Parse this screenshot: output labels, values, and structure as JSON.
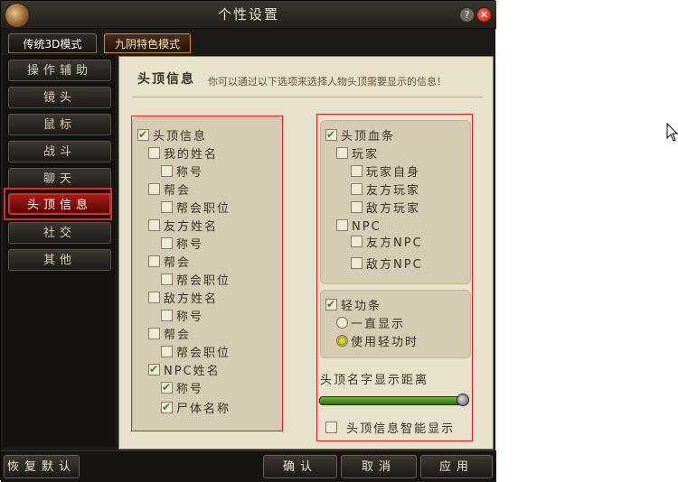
{
  "window": {
    "title": "个性设置"
  },
  "tabs": [
    {
      "label": "传统3D模式",
      "active": false
    },
    {
      "label": "九阴特色模式",
      "active": true
    }
  ],
  "sidebar": {
    "items": [
      {
        "label": "操作辅助"
      },
      {
        "label": "镜头"
      },
      {
        "label": "鼠标"
      },
      {
        "label": "战斗"
      },
      {
        "label": "聊天"
      },
      {
        "label": "头顶信息",
        "active": true
      },
      {
        "label": "社交"
      },
      {
        "label": "其他"
      }
    ]
  },
  "main": {
    "title": "头顶信息",
    "description": "你可以通过以下选项来选择人物头顶需要显示的信息！"
  },
  "left_column": {
    "items": [
      {
        "label": "头顶信息",
        "checked": true
      },
      {
        "label": "我的姓名",
        "checked": false
      },
      {
        "label": "称号",
        "checked": false
      },
      {
        "label": "帮会",
        "checked": false
      },
      {
        "label": "帮会职位",
        "checked": false
      },
      {
        "label": "友方姓名",
        "checked": false
      },
      {
        "label": "称号",
        "checked": false
      },
      {
        "label": "帮会",
        "checked": false
      },
      {
        "label": "帮会职位",
        "checked": false
      },
      {
        "label": "敌方姓名",
        "checked": false
      },
      {
        "label": "称号",
        "checked": false
      },
      {
        "label": "帮会",
        "checked": false
      },
      {
        "label": "帮会职位",
        "checked": false
      },
      {
        "label": "NPC姓名",
        "checked": true
      },
      {
        "label": "称号",
        "checked": true
      },
      {
        "label": "尸体名称",
        "checked": true
      }
    ]
  },
  "right_column": {
    "hp_items": [
      {
        "label": "头顶血条",
        "checked": true
      },
      {
        "label": "玩家",
        "checked": false
      },
      {
        "label": "玩家自身",
        "checked": false
      },
      {
        "label": "友方玩家",
        "checked": false
      },
      {
        "label": "敌方玩家",
        "checked": false
      },
      {
        "label": "NPC",
        "checked": false
      },
      {
        "label": "友方NPC",
        "checked": false
      },
      {
        "label": "敌方NPC",
        "checked": false
      }
    ],
    "qinggong": {
      "label": "轻功条",
      "checked": true,
      "options": [
        {
          "label": "一直显示",
          "selected": false
        },
        {
          "label": "使用轻功时",
          "selected": true
        }
      ]
    },
    "distance": {
      "label": "头顶名字显示距离",
      "value_fraction": 0.97
    },
    "smart_display": {
      "label": "头顶信息智能显示",
      "checked": false
    }
  },
  "buttons": {
    "reset": "恢复默认",
    "confirm": "确认",
    "cancel": "取消",
    "apply": "应用"
  },
  "colors": {
    "accent_red": "#d3302a",
    "check_green": "#3a8a18",
    "panel_bg": "#e9e1cc"
  },
  "icons": {
    "logo": "game-logo-icon",
    "help": "help-icon",
    "close": "close-icon"
  }
}
